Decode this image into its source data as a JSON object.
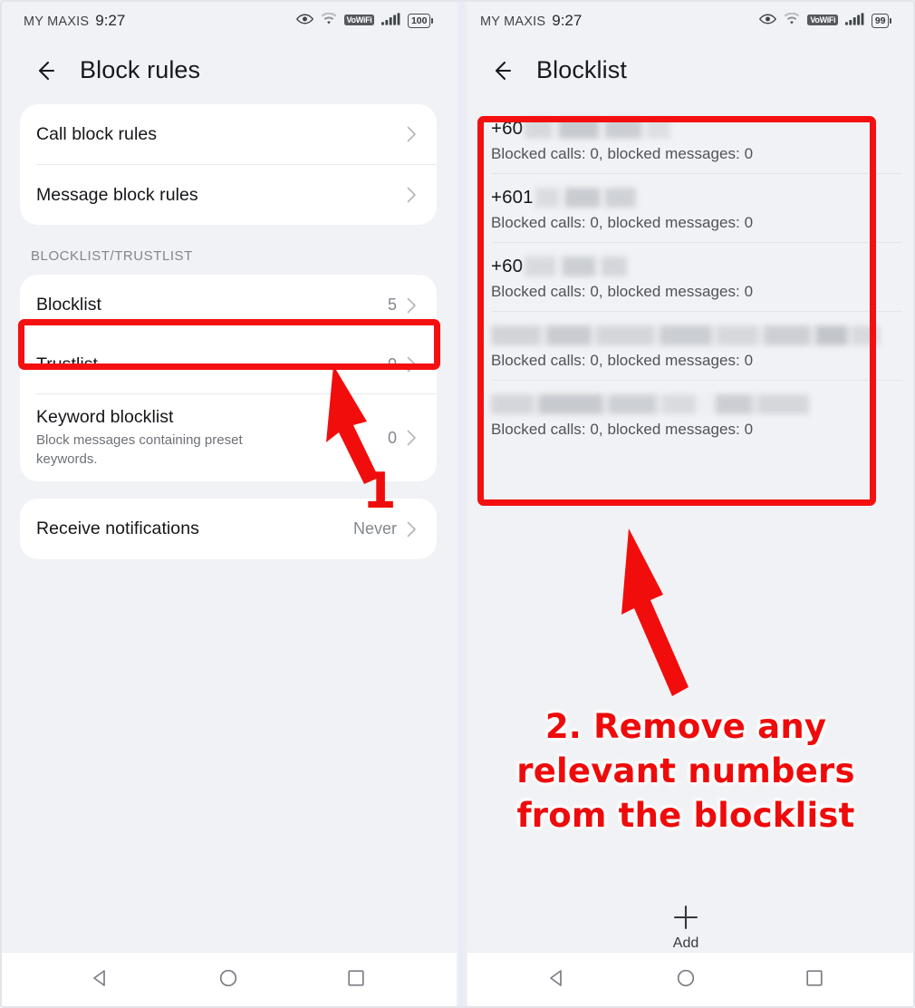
{
  "left_screen": {
    "status_bar": {
      "carrier": "MY MAXIS",
      "time": "9:27",
      "vowifi_badge": "VoWiFi",
      "battery": "100",
      "icons": [
        "eye-icon",
        "wifi-icon",
        "vowifi-badge",
        "signal-bars-icon",
        "battery-icon"
      ]
    },
    "app_bar": {
      "back_icon": "back-arrow-icon",
      "title": "Block rules"
    },
    "rules_card": [
      {
        "title": "Call block rules",
        "value": "",
        "chevron": true
      },
      {
        "title": "Message block rules",
        "value": "",
        "chevron": true
      }
    ],
    "group_label": "BLOCKLIST/TRUSTLIST",
    "list_card": [
      {
        "title": "Blocklist",
        "subtitle": "",
        "value": "5",
        "chevron": true
      },
      {
        "title": "Trustlist",
        "subtitle": "",
        "value": "0",
        "chevron": true
      },
      {
        "title": "Keyword blocklist",
        "subtitle": "Block messages containing preset keywords.",
        "value": "0",
        "chevron": true
      }
    ],
    "notifications_card": [
      {
        "title": "Receive notifications",
        "value": "Never",
        "chevron": true
      }
    ],
    "annotation": {
      "step_number": "1"
    },
    "nav_bar": [
      "back-triangle-icon",
      "home-circle-icon",
      "recents-square-icon"
    ]
  },
  "right_screen": {
    "status_bar": {
      "carrier": "MY MAXIS",
      "time": "9:27",
      "vowifi_badge": "VoWiFi",
      "battery": "99",
      "icons": [
        "eye-icon",
        "wifi-icon",
        "vowifi-badge",
        "signal-bars-icon",
        "battery-icon"
      ]
    },
    "app_bar": {
      "back_icon": "back-arrow-icon",
      "title": "Blocklist"
    },
    "blocklist_items": [
      {
        "number_prefix": "+60",
        "redacted": true,
        "meta": "Blocked calls: 0, blocked messages: 0"
      },
      {
        "number_prefix": "+601",
        "redacted": true,
        "meta": "Blocked calls: 0, blocked messages: 0"
      },
      {
        "number_prefix": "+60",
        "redacted": true,
        "meta": "Blocked calls: 0, blocked messages: 0"
      },
      {
        "number_prefix": "",
        "redacted": true,
        "meta": "Blocked calls: 0, blocked messages: 0"
      },
      {
        "number_prefix": "",
        "redacted": true,
        "meta": "Blocked calls: 0, blocked messages: 0"
      }
    ],
    "add_button": {
      "label": "Add",
      "icon": "plus-icon"
    },
    "annotation": {
      "callout_text": "2. Remove any relevant numbers from the blocklist"
    },
    "nav_bar": [
      "back-triangle-icon",
      "home-circle-icon",
      "recents-square-icon"
    ]
  },
  "colors": {
    "annotation_red": "#f41010",
    "screen_background": "#f1f2f5",
    "card_background": "#ffffff"
  }
}
